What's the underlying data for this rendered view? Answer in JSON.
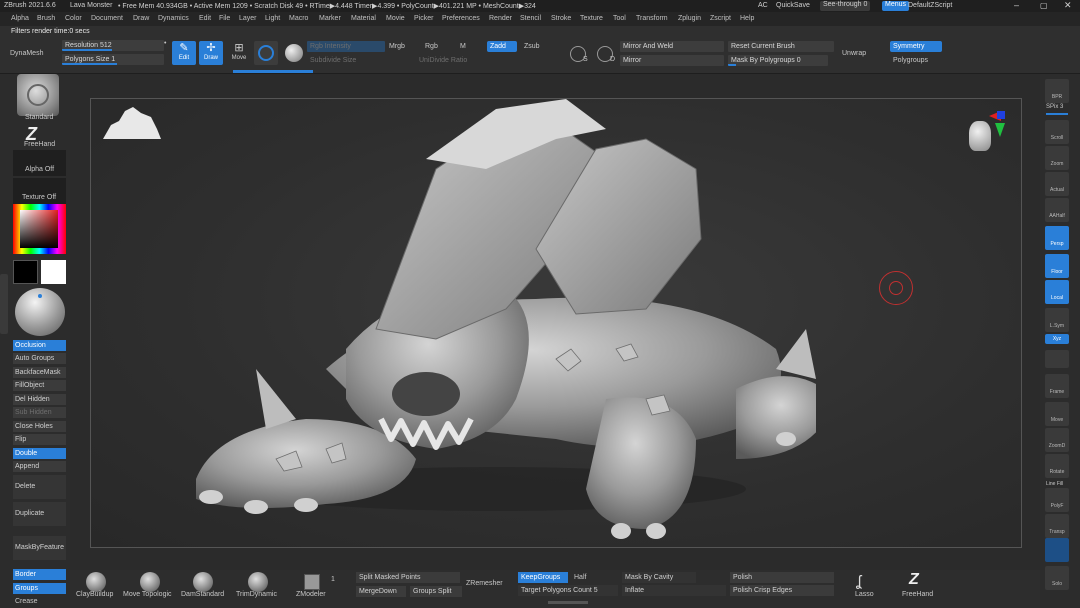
{
  "titlebar": {
    "app": "ZBrush 2021.6.6",
    "project": "Lava Monster",
    "stats": "• Free Mem 40.934GB • Active Mem 1209 • Scratch Disk 49 • RTime▶4.448 Timer▶4.399 • PolyCount▶401.221 MP • MeshCount▶324",
    "ac": "AC",
    "quicksave": "QuickSave",
    "see_through": "See-through  0",
    "menus": "Menus",
    "script": "DefaultZScript"
  },
  "menubar": [
    "Alpha",
    "Brush",
    "Color",
    "Document",
    "Draw",
    "Dynamics",
    "Edit",
    "File",
    "Layer",
    "Light",
    "Macro",
    "Marker",
    "Material",
    "Movie",
    "Picker",
    "Preferences",
    "Render",
    "Stencil",
    "Stroke",
    "Texture",
    "Tool",
    "Transform",
    "Zplugin",
    "Zscript",
    "Help"
  ],
  "status": "Filters render time:0 secs",
  "toolbar": {
    "dynamesh": "DynaMesh",
    "resolution": "Resolution 512",
    "polygons_size": "Polygons Size 1",
    "edit": "Edit",
    "draw": "Draw",
    "move": "Move",
    "zsub_group": "Rgb",
    "mrgb": "Mrgb",
    "m": "M",
    "zadd": "Zadd",
    "zsub": "Zsub",
    "sub_subdivide": "Subdivide Size",
    "rgb_intensity": "Rgb Intensity",
    "draw_size": "Draw Size",
    "uni_divide": "UniDivide Ratio",
    "s_label": "S",
    "d_label": "D",
    "mirror_weld": "Mirror And Weld",
    "mirror": "Mirror",
    "reset_brush": "Reset Current Brush",
    "mask_by_polygroups": "Mask By Polygroups 0",
    "unwrap": "Unwrap",
    "symmetry": "Symmetry",
    "polygroups": "Polygroups"
  },
  "left": {
    "standard": "Standard",
    "freehand": "FreeHand",
    "alpha_off": "Alpha Off",
    "texture_off": "Texture Off",
    "buttons": [
      "Occlusion",
      "Auto Groups",
      "BackfaceMask",
      "FillObject",
      "Del Hidden",
      "Sub Hidden",
      "Close Holes",
      "Flip",
      "Double",
      "Append"
    ],
    "big": [
      "Delete",
      "Duplicate",
      "MaskByFeature"
    ],
    "border": "Border",
    "groups": "Groups",
    "crease": "Crease"
  },
  "right": {
    "bpr": "BPR",
    "spix": "SPix 3",
    "items": [
      "Scroll",
      "Zoom",
      "Actual",
      "AAHalf",
      "Persp",
      "Floor",
      "Local",
      "L.Sym",
      "Xyz",
      "",
      "Frame",
      "Move",
      "ZoomD",
      "Rotate",
      "Line Fill",
      "PolyF",
      "Transp",
      "",
      "Solo"
    ]
  },
  "bottom": {
    "brushes": [
      "ClayBuildup",
      "Move Topologic",
      "DamStandard",
      "TrimDynamic",
      "ZModeler"
    ],
    "zmodeler_count": "1",
    "split_masked": "Split Masked Points",
    "merge_down": "MergeDown",
    "groups_split": "Groups Split",
    "zremesher": "ZRemesher",
    "keep_groups": "KeepGroups",
    "half": "Half",
    "target_count": "Target Polygons Count 5",
    "mask_by_cavity": "Mask By Cavity",
    "inflate": "Inflate",
    "polish": "Polish",
    "polish_crisp": "Polish Crisp Edges",
    "lasso": "Lasso",
    "freehand": "FreeHand"
  },
  "colors": {
    "accent": "#2a7fd8",
    "primary": "#ffffff",
    "secondary": "#000000"
  }
}
